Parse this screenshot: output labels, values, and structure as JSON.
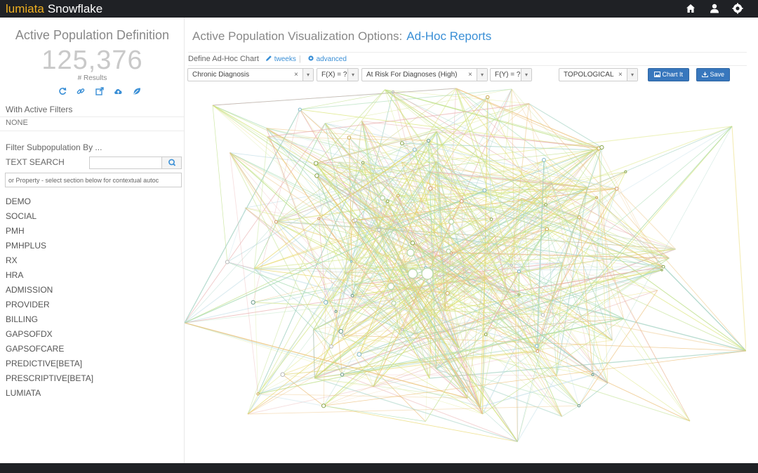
{
  "app": {
    "brand_part1": "lumiata",
    "brand_part2": "Snowflake",
    "top_icons": [
      "home-icon",
      "user-icon",
      "settings-icon"
    ]
  },
  "left_panel": {
    "title": "Active Population Definition",
    "count": "125,376",
    "count_label": "# Results",
    "action_icons": [
      "refresh-icon",
      "link-icon",
      "external-link-icon",
      "cloud-upload-icon",
      "leaf-icon"
    ],
    "active_filters_label": "With Active Filters",
    "active_filters_value": "NONE",
    "filter_label": "Filter Subpopulation By ...",
    "text_search_label": "TEXT SEARCH",
    "search_value": "",
    "property_value": "or Property - select section below for contextual autoc",
    "categories": [
      "DEMO",
      "SOCIAL",
      "PMH",
      "PMHPLUS",
      "RX",
      "HRA",
      "ADMISSION",
      "PROVIDER",
      "BILLING",
      "GAPSOFDX",
      "GAPSOFCARE",
      "PREDICTIVE[BETA]",
      "PRESCRIPTIVE[BETA]",
      "LUMIATA"
    ]
  },
  "main": {
    "title": "Active Population Visualization Options:",
    "title_link": "Ad-Hoc Reports",
    "define_label": "Define Ad-Hoc Chart",
    "tweeks_label": "tweeks",
    "separator": "|",
    "advanced_label": "advanced",
    "x_select": "Chronic Diagnosis",
    "fx_select": "F(X) = ?",
    "y_select": "At Risk For Diagnoses (High)",
    "fy_select": "F(Y) = ?",
    "type_select": "TOPOLOGICAL",
    "clear_glyph": "×",
    "caret_glyph": "▾",
    "chart_button": "Chart It",
    "save_button": "Save"
  },
  "colors": {
    "accent": "#3a8fd6",
    "button": "#3877bd",
    "brand_orange": "#f0b020",
    "topbar": "#1f2125"
  }
}
